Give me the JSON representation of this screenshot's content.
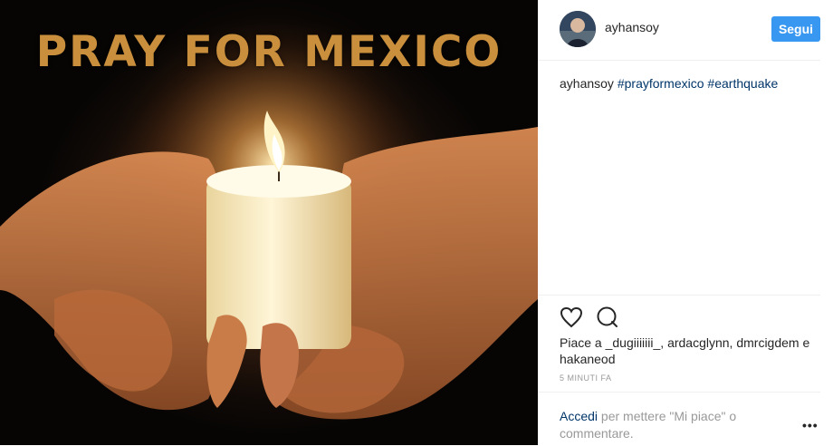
{
  "photo": {
    "title": "PRAY FOR MEXICO"
  },
  "header": {
    "username": "ayhansoy",
    "follow_label": "Segui"
  },
  "caption": {
    "username": "ayhansoy",
    "tags": [
      "#prayformexico",
      "#earthquake"
    ]
  },
  "likes": {
    "text": "Piace a _dugiiiiiii_, ardacglynn, dmrcigdem e hakaneod"
  },
  "time": "5 MINUTI FA",
  "login": {
    "link": "Accedi",
    "text": " per mettere \"Mi piace\" o commentare.",
    "more": "•••"
  },
  "icons": [
    "heart-icon",
    "comment-icon",
    "more-options-icon"
  ]
}
